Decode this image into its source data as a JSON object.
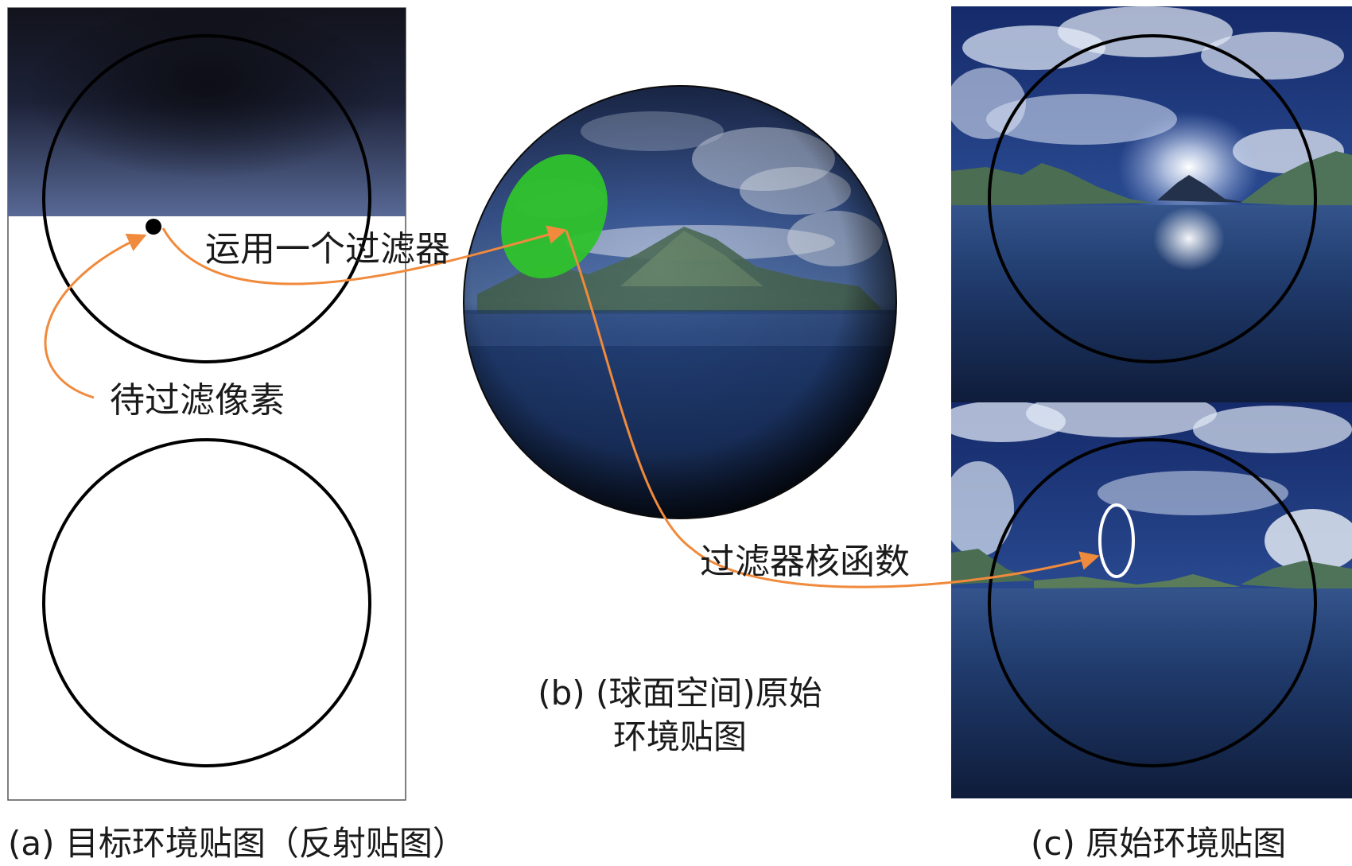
{
  "annotations": {
    "apply_filter": "运用一个过滤器",
    "pixel_to_filter": "待过滤像素",
    "filter_kernel": "过滤器核函数"
  },
  "captions": {
    "a": "(a) 目标环境贴图（反射贴图）",
    "b_line1": "(b) (球面空间)原始",
    "b_line2": "环境贴图",
    "c": "(c) 原始环境贴图"
  },
  "colors": {
    "arrow": "#f08a3c",
    "kernel_fill": "#2fc22c",
    "kernel_outline": "#ffffff",
    "circle_stroke": "#000000",
    "sky_dark": "#141627",
    "sky_mid": "#3c4a78",
    "water": "#243d6e"
  },
  "icons": [
    "pixel-dot-icon",
    "arrowhead-icon"
  ]
}
